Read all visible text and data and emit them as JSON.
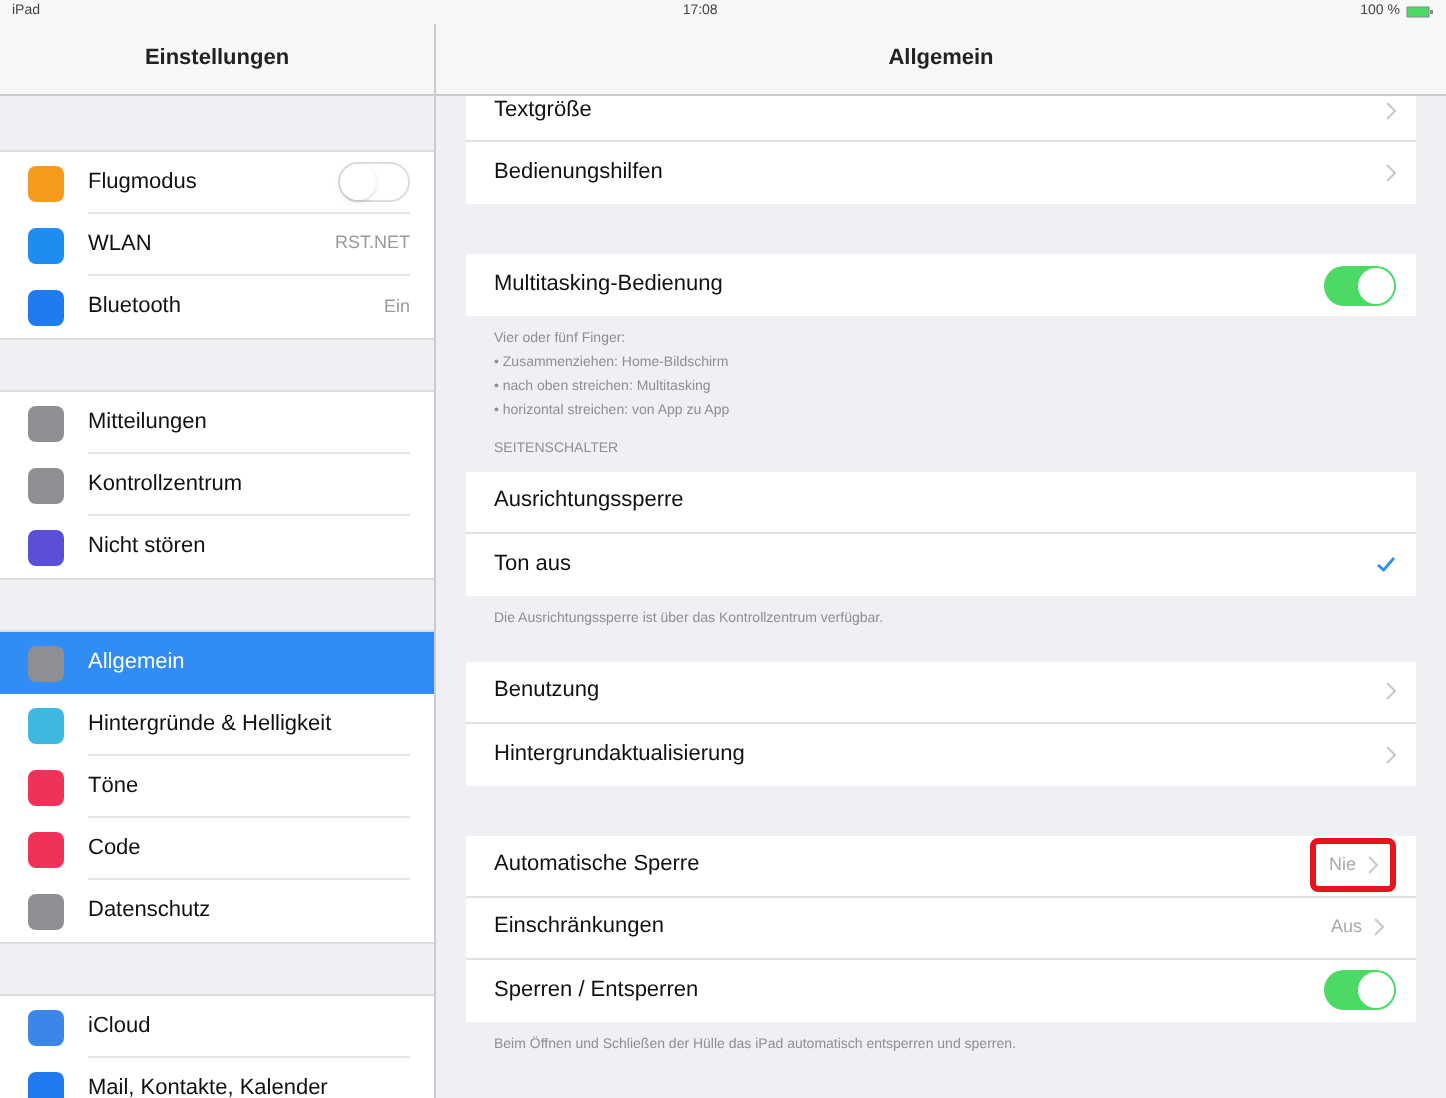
{
  "status_bar": {
    "device": "iPad",
    "time": "17:08",
    "battery": "100 %"
  },
  "sidebar": {
    "title": "Einstellungen",
    "sections": [
      [
        {
          "label": "Flugmodus",
          "color": "#f59a1b",
          "kind": "toggle",
          "on": false,
          "selected": false
        },
        {
          "label": "WLAN",
          "color": "#1e8cf0",
          "kind": "value",
          "value": "RST.NET",
          "selected": false
        },
        {
          "label": "Bluetooth",
          "color": "#1e7cf0",
          "kind": "value",
          "value": "Ein",
          "selected": false
        }
      ],
      [
        {
          "label": "Mitteilungen",
          "color": "#8e8e93",
          "kind": "plain",
          "selected": false
        },
        {
          "label": "Kontrollzentrum",
          "color": "#8e8e93",
          "kind": "plain",
          "selected": false
        },
        {
          "label": "Nicht stören",
          "color": "#5a4fd6",
          "kind": "plain",
          "selected": false
        }
      ],
      [
        {
          "label": "Allgemein",
          "color": "#8e8e93",
          "kind": "plain",
          "selected": true
        },
        {
          "label": "Hintergründe & Helligkeit",
          "color": "#3fb8e0",
          "kind": "plain",
          "selected": false
        },
        {
          "label": "Töne",
          "color": "#f0325a",
          "kind": "plain",
          "selected": false
        },
        {
          "label": "Code",
          "color": "#f0325a",
          "kind": "plain",
          "selected": false
        },
        {
          "label": "Datenschutz",
          "color": "#8e8e93",
          "kind": "plain",
          "selected": false
        }
      ],
      [
        {
          "label": "iCloud",
          "color": "#3b86e8",
          "kind": "plain",
          "selected": false
        },
        {
          "label": "Mail, Kontakte, Kalender",
          "color": "#1e7cf0",
          "kind": "plain",
          "selected": false
        }
      ]
    ]
  },
  "detail": {
    "title": "Allgemein",
    "groups": [
      {
        "rows": [
          {
            "label": "Textgröße",
            "kind": "chevron"
          },
          {
            "label": "Bedienungshilfen",
            "kind": "chevron"
          }
        ]
      },
      {
        "rows": [
          {
            "label": "Multitasking-Bedienung",
            "kind": "toggle",
            "on": true
          }
        ],
        "footer": [
          "Vier oder fünf Finger:",
          "• Zusammenziehen: Home-Bildschirm",
          "• nach oben streichen: Multitasking",
          "• horizontal streichen: von App zu App"
        ]
      },
      {
        "header": "SEITENSCHALTER",
        "rows": [
          {
            "label": "Ausrichtungssperre",
            "kind": "check",
            "selected": false
          },
          {
            "label": "Ton aus",
            "kind": "check",
            "selected": true
          }
        ],
        "footer": [
          "Die Ausrichtungssperre ist über das Kontrollzentrum verfügbar."
        ]
      },
      {
        "rows": [
          {
            "label": "Benutzung",
            "kind": "chevron"
          },
          {
            "label": "Hintergrundaktualisierung",
            "kind": "chevron"
          }
        ]
      },
      {
        "rows": [
          {
            "label": "Automatische Sperre",
            "kind": "chevron",
            "value": "Nie",
            "highlighted": true
          },
          {
            "label": "Einschränkungen",
            "kind": "chevron",
            "value": "Aus"
          },
          {
            "label": "Sperren / Entsperren",
            "kind": "toggle",
            "on": true
          }
        ],
        "footer": [
          "Beim Öffnen und Schließen der Hülle das iPad automatisch entsperren und sperren."
        ]
      }
    ]
  }
}
